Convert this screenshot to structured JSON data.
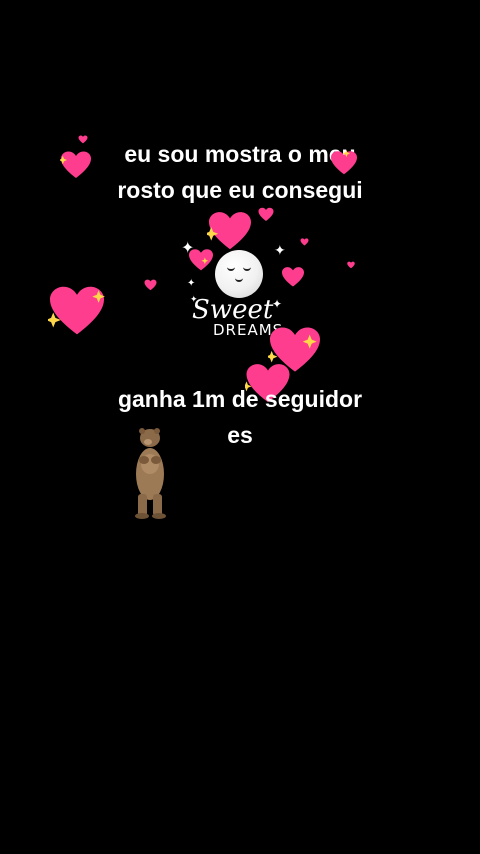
{
  "caption_top": {
    "line1": "eu sou mostra o meu",
    "line2": "rosto que eu consegui"
  },
  "caption_bottom": {
    "line1": "ganha 1m de seguidor",
    "line2": "es"
  },
  "sticker": {
    "sweet": "Sweet",
    "dreams": "DREAMS"
  },
  "colors": {
    "background": "#000000",
    "text": "#ffffff",
    "heart": "#ff3d8f",
    "sparkle": "#ffd84a"
  },
  "icons": [
    "heart-icon",
    "sparkle-icon",
    "moon-icon",
    "bear-sticker"
  ]
}
